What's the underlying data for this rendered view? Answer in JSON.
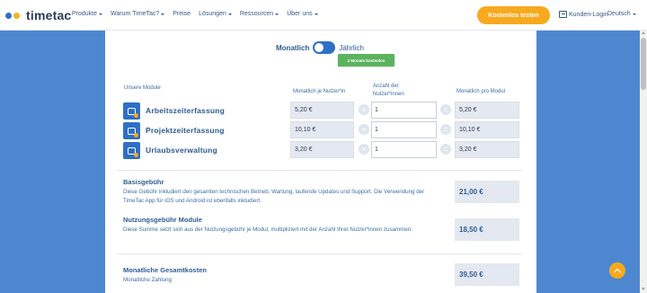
{
  "header": {
    "brand": "timetac",
    "nav": [
      {
        "label": "Produkte",
        "dropdown": true
      },
      {
        "label": "Warum TimeTac?",
        "dropdown": true
      },
      {
        "label": "Preise",
        "dropdown": false
      },
      {
        "label": "Lösungen",
        "dropdown": true
      },
      {
        "label": "Ressourcen",
        "dropdown": true
      },
      {
        "label": "Über uns",
        "dropdown": true
      }
    ],
    "cta": "Kostenlos testen",
    "login": "Kunden-Login",
    "language": "Deutsch"
  },
  "toggle": {
    "left_label": "Monatlich",
    "right_label": "Jährlich",
    "badge": "2 Monate kostenlos"
  },
  "columns": {
    "modules": "Unsere Module",
    "price_per_user": "Monatlich je Nutzer*in",
    "user_count": "Anzahl der Nutzer*innen",
    "monthly_per_module": "Monatlich pro Modul"
  },
  "modules": [
    {
      "name": "Arbeitszeiterfassung",
      "price": "5,20 €",
      "qty": "1",
      "total": "5,20 €"
    },
    {
      "name": "Projektzeiterfassung",
      "price": "10,10 €",
      "qty": "1",
      "total": "10,10 €"
    },
    {
      "name": "Urlaubsverwaltung",
      "price": "3,20 €",
      "qty": "1",
      "total": "3,20 €"
    }
  ],
  "basis": {
    "title": "Basisgebühr",
    "desc": "Diese Gebühr inkludiert den gesamten technischen Betrieb, Wartung, laufende Updates und Support. Die Verwendung der TimeTac App für iOS und Android ist ebenfalls inkludiert.",
    "amount": "21,00 €"
  },
  "usage": {
    "title": "Nutzungsgebühr Module",
    "desc": "Diese Summe setzt sich aus der Nutzungsgebühr je Modul, multipliziert mit der Anzahl Ihrer Nutzer*innen zusammen.",
    "amount": "18,50 €"
  },
  "total": {
    "title": "Monatliche Gesamtkosten",
    "subtitle": "Monatliche Zahlung",
    "amount": "39,50 €"
  },
  "colors": {
    "accent": "#2f6fc7",
    "cta": "#f8a91d",
    "badge": "#5cb35f",
    "page_bg": "#4d87cf"
  }
}
